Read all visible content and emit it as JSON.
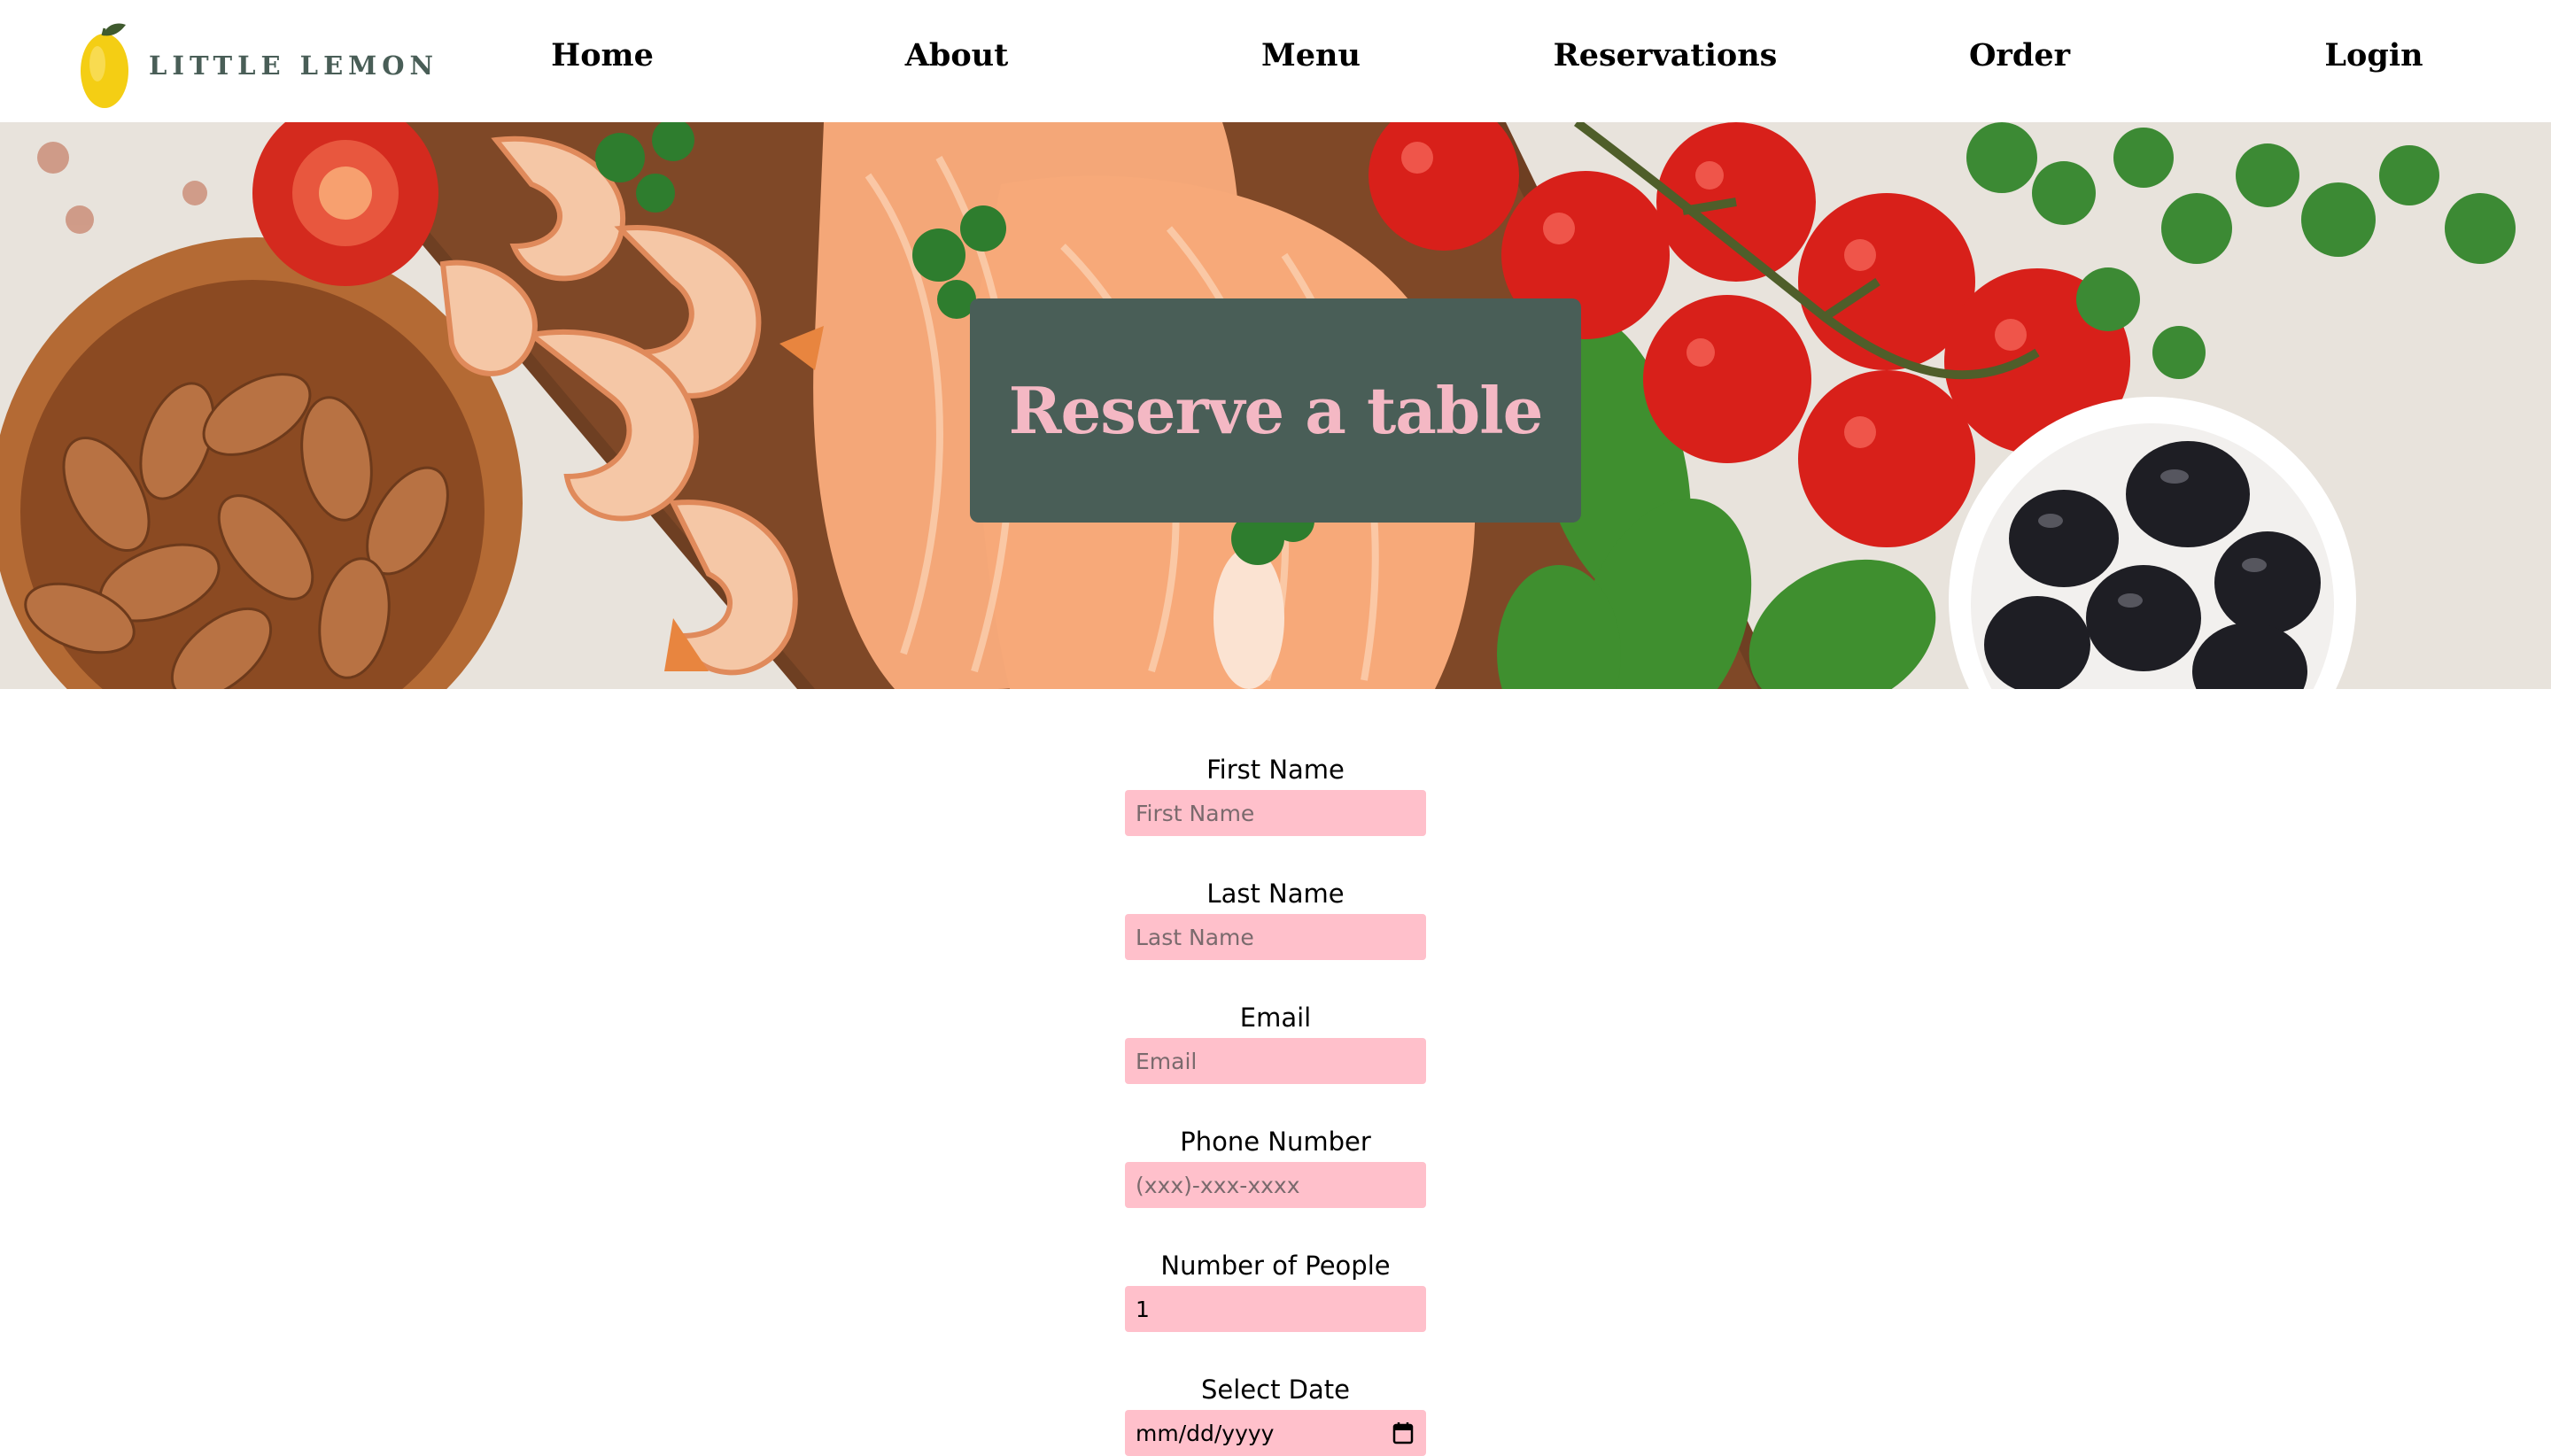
{
  "brand": {
    "name": "LITTLE LEMON"
  },
  "nav": {
    "items": [
      {
        "label": "Home"
      },
      {
        "label": "About"
      },
      {
        "label": "Menu"
      },
      {
        "label": "Reservations"
      },
      {
        "label": "Order"
      },
      {
        "label": "Login"
      }
    ]
  },
  "hero": {
    "title": "Reserve a table"
  },
  "form": {
    "first_name": {
      "label": "First Name",
      "placeholder": "First Name"
    },
    "last_name": {
      "label": "Last Name",
      "placeholder": "Last Name"
    },
    "email": {
      "label": "Email",
      "placeholder": "Email"
    },
    "phone": {
      "label": "Phone Number",
      "placeholder": "(xxx)-xxx-xxxx"
    },
    "people": {
      "label": "Number of People",
      "value": "1"
    },
    "date": {
      "label": "Select Date",
      "placeholder": "mm/dd/yyyy"
    }
  },
  "colors": {
    "brand_green": "#495e57",
    "title_pink": "#f4b8c4",
    "input_pink": "#ffc0cb"
  },
  "icons": {
    "logo": "lemon-icon",
    "date_picker": "calendar-icon"
  }
}
